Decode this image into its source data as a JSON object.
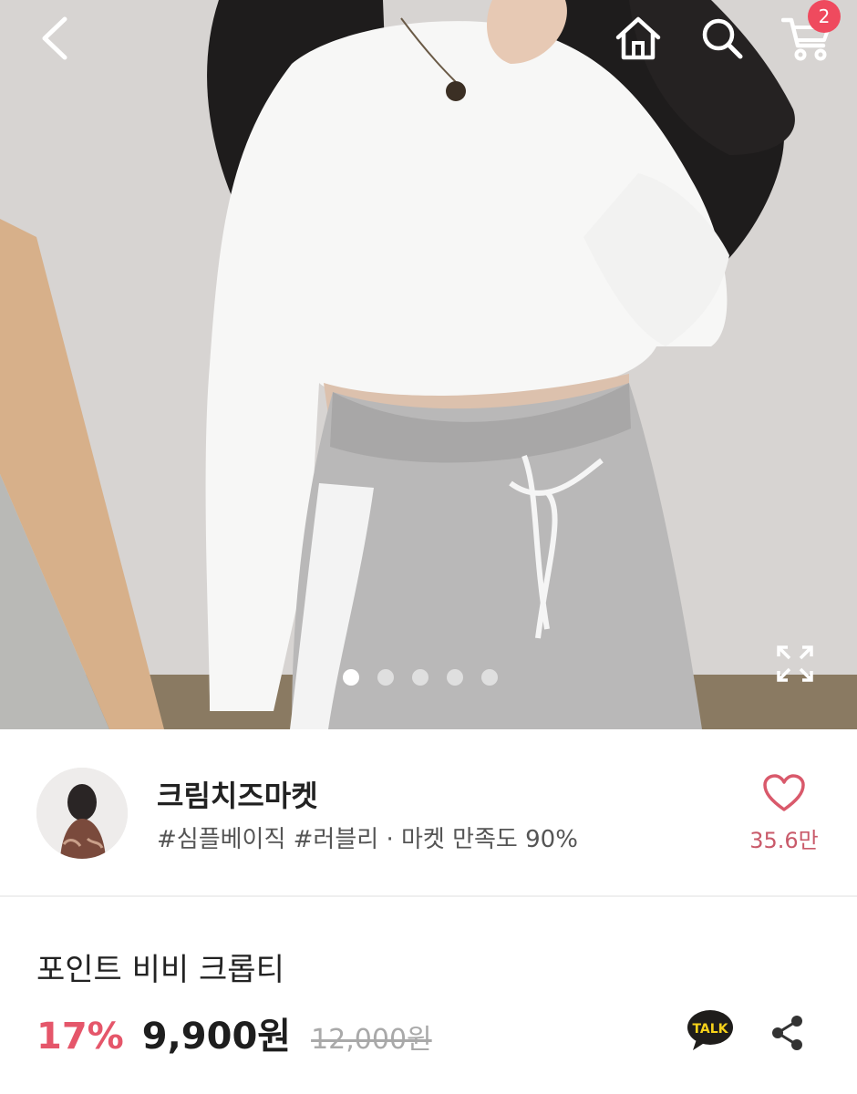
{
  "header": {
    "back_icon": "chevron-left-icon",
    "home_icon": "home-icon",
    "search_icon": "search-icon",
    "cart_icon": "cart-icon",
    "cart_count": "2"
  },
  "gallery": {
    "image": "product photo: white cropped long-sleeve tee with grey jogger pants",
    "slide_count": 5,
    "active_slide": 1,
    "expand_icon": "expand-icon"
  },
  "seller": {
    "name": "크림치즈마켓",
    "tags": "#심플베이직 #러블리 · 마켓 만족도 90%",
    "like_icon": "heart-outline-icon",
    "like_count": "35.6만"
  },
  "product": {
    "title": "포인트 비비 크롭티",
    "discount": "17%",
    "price": "9,900원",
    "original_price": "12,000원",
    "talk_label": "TALK",
    "share_icon": "share-icon"
  },
  "colors": {
    "accent": "#ef4a5e",
    "discount": "#e5566a",
    "like": "#c95a6a",
    "talk_yellow": "#f7d21a"
  }
}
